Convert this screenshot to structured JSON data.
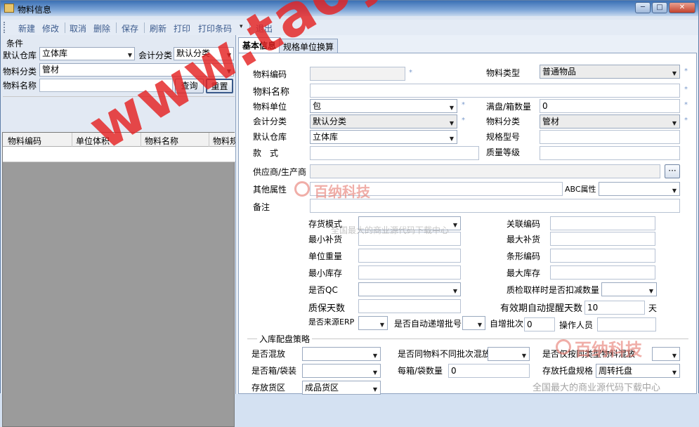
{
  "window": {
    "title": "物料信息",
    "min_label": "─",
    "max_label": "□",
    "close_label": "✕"
  },
  "toolbar": {
    "buttons": [
      "新建",
      "修改",
      "取消",
      "删除",
      "保存",
      "刷新",
      "打印",
      "打印条码",
      "退出"
    ],
    "dropdown_glyph": "▾"
  },
  "left": {
    "condition_title": "条件",
    "warehouse_label": "默认仓库",
    "warehouse_value": "立体库",
    "account_class_label": "会计分类",
    "account_class_value": "默认分类",
    "material_class_label": "物料分类",
    "material_class_value": "管材",
    "material_name_label": "物料名称",
    "material_name_value": "",
    "query_button": "查询",
    "reset_button": "重置",
    "grid_columns": [
      "物料编码",
      "单位体积",
      "物料名称",
      "物料规"
    ]
  },
  "tabs": [
    "基本信息",
    "规格单位换算"
  ],
  "form": {
    "material_code_label": "物料编码",
    "material_code_value": "",
    "material_type_label": "物料类型",
    "material_type_value": "普通物品",
    "material_name_label": "物料名称",
    "material_name_value": "",
    "unit_label": "物料单位",
    "unit_value": "包",
    "box_qty_label": "满盘/箱数量",
    "box_qty_value": "0",
    "account_class_label": "会计分类",
    "account_class_value": "默认分类",
    "material_class_label": "物料分类",
    "material_class_value": "管材",
    "warehouse_label": "默认仓库",
    "warehouse_value": "立体库",
    "spec_label": "规格型号",
    "spec_value": "",
    "style_label": "款　式",
    "style_value": "",
    "quality_level_label": "质量等级",
    "quality_level_value": "",
    "supplier_label": "供应商/生产商",
    "supplier_value": "",
    "browse_label": "···",
    "other_attr_label": "其他属性",
    "other_attr_value": "",
    "abc_label": "ABC属性",
    "abc_value": "",
    "remark_label": "备注",
    "remark_value": "",
    "stock_mode_label": "存货模式",
    "stock_mode_value": "",
    "related_code_label": "关联编码",
    "related_code_value": "",
    "min_replenish_label": "最小补货",
    "min_replenish_value": "",
    "max_replenish_label": "最大补货",
    "max_replenish_value": "",
    "unit_weight_label": "单位重量",
    "unit_weight_value": "",
    "barcode_label": "条形编码",
    "barcode_value": "",
    "min_stock_label": "最小库存",
    "min_stock_value": "",
    "max_stock_label": "最大库存",
    "max_stock_value": "",
    "is_qc_label": "是否QC",
    "is_qc_value": "",
    "qc_deduct_label": "质检取样时是否扣减数量",
    "qc_deduct_value": "",
    "shelf_life_label": "质保天数",
    "shelf_life_value": "",
    "expiry_alert_label": "有效期自动提醒天数",
    "expiry_alert_value": "10",
    "days_unit": "天",
    "from_erp_label": "是否来源ERP",
    "from_erp_value": "",
    "auto_batch_label": "是否自动递增批号",
    "auto_batch_value": "",
    "auto_batch_no_label": "自增批次",
    "auto_batch_no_value": "0",
    "operator_label": "操作人员",
    "operator_value": "",
    "strategy_group": "入库配盘策略",
    "mixed_label": "是否混放",
    "mixed_value": "",
    "mixed_batch_label": "是否同物料不同批次混放",
    "mixed_batch_value": "",
    "same_class_label": "是否仅按同类型物料混放",
    "same_class_value": "",
    "boxed_label": "是否箱/袋装",
    "boxed_value": "",
    "box_count_label": "每箱/袋数量",
    "box_count_value": "0",
    "pallet_spec_label": "存放托盘规格",
    "pallet_spec_value": "周转托盘",
    "storage_area_label": "存放货区",
    "storage_area_value": "成品货区"
  },
  "watermark": {
    "main": "www.taoydm.com",
    "logo": "百纳科技",
    "logo_sub": "全国最大的商业源代码下载中心",
    "footer": "全国最大的商业源代码下载中心"
  },
  "colors": {
    "watermark_red": "#e42222",
    "toolbar_text": "#3d5c8e",
    "titlebar": "#3a6fb4"
  }
}
